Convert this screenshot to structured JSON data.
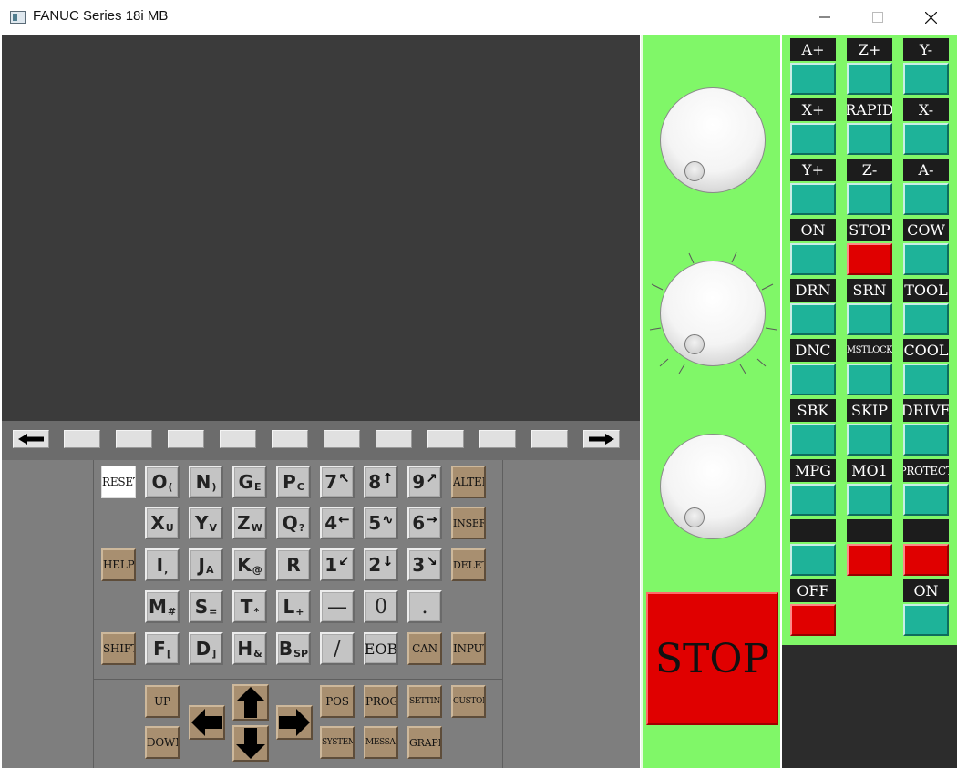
{
  "window": {
    "title": "FANUC Series 18i MB"
  },
  "keypad": {
    "rows": [
      [
        {
          "main": "RESET",
          "type": "label",
          "style": "white"
        },
        {
          "main": "O",
          "sub": "("
        },
        {
          "main": "N",
          "sub": ")"
        },
        {
          "main": "G",
          "sub": "E"
        },
        {
          "main": "P",
          "sub": "C"
        },
        {
          "main": "7",
          "sub": "↖"
        },
        {
          "main": "8",
          "sub": "↑"
        },
        {
          "main": "9",
          "sub": "↗"
        },
        {
          "main": "ALTER",
          "type": "label"
        }
      ],
      [
        {
          "main": "X",
          "sub": "U"
        },
        {
          "main": "Y",
          "sub": "V"
        },
        {
          "main": "Z",
          "sub": "W"
        },
        {
          "main": "Q",
          "sub": "?"
        },
        {
          "main": "4",
          "sub": "←"
        },
        {
          "main": "5",
          "sub": "∿"
        },
        {
          "main": "6",
          "sub": "→"
        },
        {
          "main": "INSERT",
          "type": "label"
        }
      ],
      [
        {
          "main": "HELP",
          "type": "label"
        },
        {
          "main": "I",
          "sub": ","
        },
        {
          "main": "J",
          "sub": "A"
        },
        {
          "main": "K",
          "sub": "@"
        },
        {
          "main": "R",
          "sub": ""
        },
        {
          "main": "1",
          "sub": "↙"
        },
        {
          "main": "2",
          "sub": "↓"
        },
        {
          "main": "3",
          "sub": "↘"
        },
        {
          "main": "DELETE",
          "type": "label"
        }
      ],
      [
        {
          "main": "M",
          "sub": "#"
        },
        {
          "main": "S",
          "sub": "="
        },
        {
          "main": "T",
          "sub": "*"
        },
        {
          "main": "L",
          "sub": "+"
        },
        {
          "main": "—",
          "type": "big"
        },
        {
          "main": "0",
          "type": "big"
        },
        {
          "main": ".",
          "type": "big"
        }
      ],
      [
        {
          "main": "SHIFT",
          "type": "label"
        },
        {
          "main": "F",
          "sub": "["
        },
        {
          "main": "D",
          "sub": "]"
        },
        {
          "main": "H",
          "sub": "&"
        },
        {
          "main": "B",
          "sub": "SP"
        },
        {
          "main": "/",
          "type": "big"
        },
        {
          "main": "EOB",
          "type": "eob"
        },
        {
          "main": "CAN",
          "type": "label"
        },
        {
          "main": "INPUT",
          "type": "label"
        }
      ]
    ],
    "function_keys": [
      "UP",
      "DOWN",
      "POS",
      "PROG",
      "SETTING",
      "CUSTOM",
      "SYSTEM",
      "MESSAGE",
      "GRAPH"
    ]
  },
  "controls": [
    {
      "label": "A+",
      "color": "teal"
    },
    {
      "label": "Z+",
      "color": "teal"
    },
    {
      "label": "Y-",
      "color": "teal"
    },
    {
      "label": "X+",
      "color": "teal"
    },
    {
      "label": "RAPID",
      "color": "teal"
    },
    {
      "label": "X-",
      "color": "teal"
    },
    {
      "label": "Y+",
      "color": "teal"
    },
    {
      "label": "Z-",
      "color": "teal"
    },
    {
      "label": "A-",
      "color": "teal"
    },
    {
      "label": "ON",
      "color": "teal"
    },
    {
      "label": "STOP",
      "color": "red"
    },
    {
      "label": "COW",
      "color": "teal"
    },
    {
      "label": "DRN",
      "color": "teal"
    },
    {
      "label": "SRN",
      "color": "teal"
    },
    {
      "label": "TOOL",
      "color": "teal"
    },
    {
      "label": "DNC",
      "color": "teal"
    },
    {
      "label": "MSTLOCK",
      "color": "teal"
    },
    {
      "label": "COOL",
      "color": "teal"
    },
    {
      "label": "SBK",
      "color": "teal"
    },
    {
      "label": "SKIP",
      "color": "teal"
    },
    {
      "label": "DRIVE",
      "color": "teal"
    },
    {
      "label": "MPG",
      "color": "teal"
    },
    {
      "label": "MO1",
      "color": "teal"
    },
    {
      "label": "PROTECT",
      "color": "teal"
    },
    {
      "label": "",
      "color": "teal"
    },
    {
      "label": "",
      "color": "red"
    },
    {
      "label": "",
      "color": "red"
    }
  ],
  "power": {
    "off_label": "OFF",
    "on_label": "ON"
  },
  "emergency": {
    "label": "STOP"
  },
  "colors": {
    "screen": "#3b3b3b",
    "panel_green": "#80f768",
    "button_teal": "#1eb399",
    "button_red": "#e00000",
    "key_brown": "#a88f70",
    "key_grey": "#c4c4c4"
  }
}
